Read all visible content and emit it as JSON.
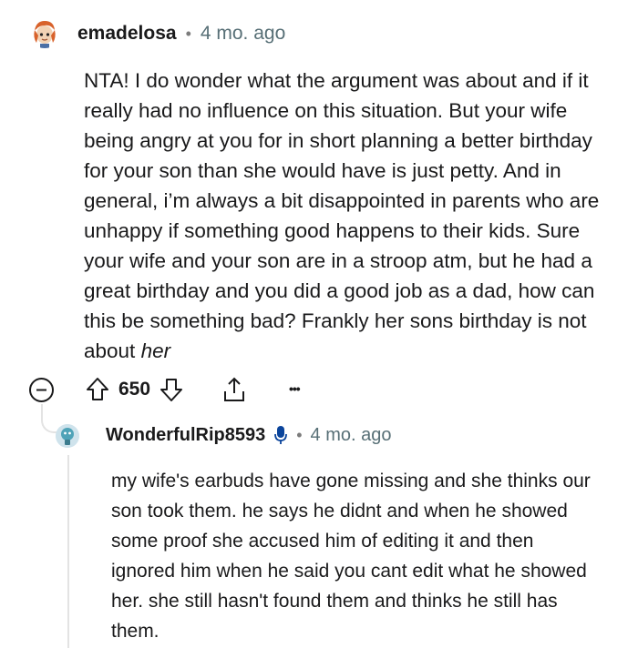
{
  "comment": {
    "username": "emadelosa",
    "separator": "•",
    "time": "4 mo. ago",
    "body_main": "NTA! I do wonder what the argument was about and if it really had no influence on this situation. But your wife being angry at you for in short planning a better birthday for your son than she would have is just petty. And in general, i’m always a bit disappointed in parents who are unhappy if something good happens to their kids. Sure your wife and your son are in a stroop atm, but he had a great birthday and you did a good job as a dad, how can this be something bad? Frankly her sons birthday is not about ",
    "body_emphasis": "her",
    "upvotes": "650",
    "more": "•••"
  },
  "reply": {
    "username": "WonderfulRip8593",
    "separator": "•",
    "time": "4 mo. ago",
    "body": "my wife's earbuds have gone missing and she thinks our son took them. he says he didnt and when he showed some proof she accused him of editing it and then ignored him when he said you cant edit what he showed her. she still hasn't found them and thinks he still has them."
  },
  "colors": {
    "text": "#1a1a1b",
    "meta": "#576f76",
    "thread_line": "#e3e3e3",
    "mic_icon": "#0a449b"
  },
  "icons": [
    "collapse-icon",
    "upvote-icon",
    "downvote-icon",
    "share-icon",
    "more-icon",
    "microphone-icon"
  ]
}
